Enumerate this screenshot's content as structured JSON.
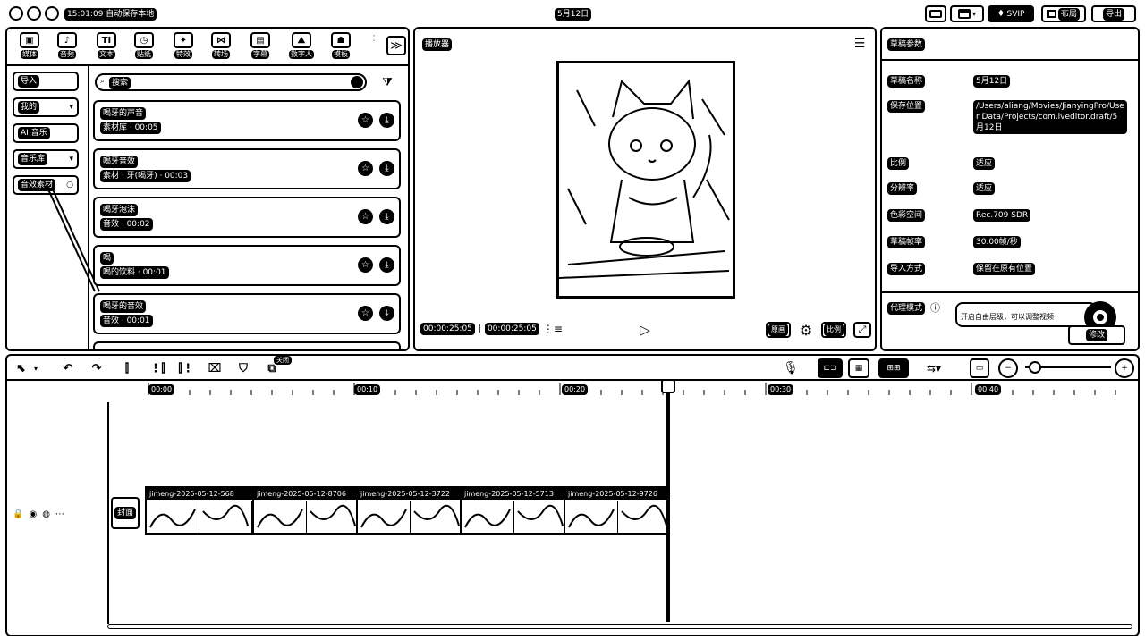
{
  "titlebar": {
    "left_badge": "15:01:09 自动保存本地",
    "project_title": "5月12日",
    "vip_label": "SVIP",
    "layout_label": "布局",
    "export_label": "导出"
  },
  "toolbar": {
    "items": [
      {
        "label": "媒体",
        "icon": "media-icon",
        "glyph": "▣"
      },
      {
        "label": "音频",
        "icon": "audio-icon",
        "glyph": "♪"
      },
      {
        "label": "文本",
        "icon": "text-icon",
        "glyph": "TI"
      },
      {
        "label": "贴纸",
        "icon": "sticker-icon",
        "glyph": "◷"
      },
      {
        "label": "特效",
        "icon": "effects-icon",
        "glyph": "✦"
      },
      {
        "label": "转场",
        "icon": "transition-icon",
        "glyph": "⋈"
      },
      {
        "label": "字幕",
        "icon": "caption-icon",
        "glyph": "▤"
      },
      {
        "label": "数字人",
        "icon": "avatar-icon",
        "glyph": "⛰"
      },
      {
        "label": "模板",
        "icon": "template-icon",
        "glyph": "☗"
      }
    ],
    "more_glyph": "≫"
  },
  "categories": [
    {
      "label": "导入",
      "glyph": ""
    },
    {
      "label": "我的",
      "glyph": "▾"
    },
    {
      "label": "AI 音乐",
      "glyph": ""
    },
    {
      "label": "音乐库",
      "glyph": "▾"
    },
    {
      "label": "音效素材",
      "glyph": "○"
    }
  ],
  "search": {
    "placeholder": "搜索",
    "filter_glyph": "⧩"
  },
  "sound_items": [
    {
      "title": "喝牙的声音",
      "subtitle": "素材库 · 00:05"
    },
    {
      "title": "喝牙音效",
      "subtitle": "素材 · 牙(喝牙) · 00:03"
    },
    {
      "title": "喝牙泡沫",
      "subtitle": "音效 · 00:02"
    },
    {
      "title": "喝",
      "subtitle": "喝的饮料 · 00:01"
    },
    {
      "title": "喝牙的音效",
      "subtitle": "音效 · 00:01"
    }
  ],
  "player": {
    "title": "播放器",
    "current_time": "00:00:25:05",
    "total_time": "00:00:25:05",
    "ratio_label": "原画",
    "fit_label": "比例"
  },
  "draft": {
    "title": "草稿参数",
    "fields": [
      {
        "label": "草稿名称",
        "value": "5月12日"
      },
      {
        "label": "保存位置",
        "value": "/Users/aliang/Movies/JianyingPro/User Data/Projects/com.lveditor.draft/5月12日"
      },
      {
        "label": "比例",
        "value": "适应"
      },
      {
        "label": "分辨率",
        "value": "适应"
      },
      {
        "label": "色彩空间",
        "value": "Rec.709 SDR"
      },
      {
        "label": "草稿帧率",
        "value": "30.00帧/秒"
      },
      {
        "label": "导入方式",
        "value": "保留在原有位置"
      }
    ],
    "mode_label": "代理模式",
    "mode_hint": "开启自由层级，可以调整视频",
    "modify_label": "修改"
  },
  "timeline": {
    "cover_label": "封面",
    "tick_labels": [
      "00:00",
      "00:10",
      "00:20",
      "00:30",
      "00:40"
    ],
    "clips": [
      {
        "name": "jimeng-2025-05-12-568"
      },
      {
        "name": "jimeng-2025-05-12-8706"
      },
      {
        "name": "jimeng-2025-05-12-3722"
      },
      {
        "name": "jimeng-2025-05-12-5713"
      },
      {
        "name": "jimeng-2025-05-12-9726"
      }
    ],
    "tooltip": "关闭"
  }
}
